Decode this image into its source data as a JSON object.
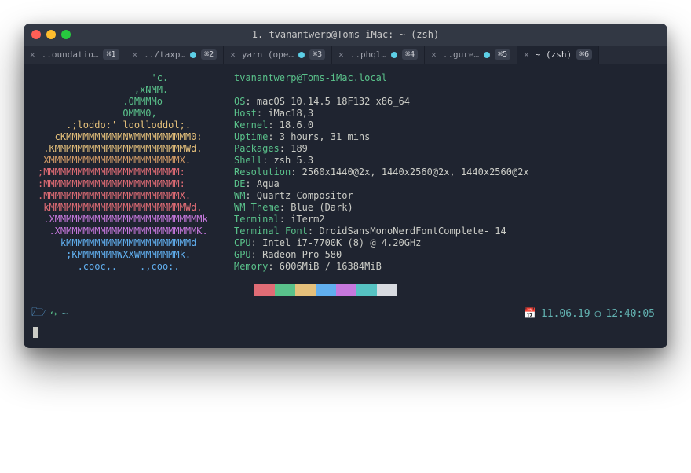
{
  "window": {
    "title": "1. tvanantwerp@Toms-iMac: ~ (zsh)"
  },
  "tabs": [
    {
      "label": "..oundatio…",
      "shortcut": "⌘1",
      "bullet": false,
      "active": false
    },
    {
      "label": "../taxp…",
      "shortcut": "⌘2",
      "bullet": true,
      "active": false
    },
    {
      "label": "yarn (ope…",
      "shortcut": "⌘3",
      "bullet": true,
      "active": false
    },
    {
      "label": "..phql…",
      "shortcut": "⌘4",
      "bullet": true,
      "active": false
    },
    {
      "label": "..gure…",
      "shortcut": "⌘5",
      "bullet": true,
      "active": false
    },
    {
      "label": "~ (zsh)",
      "shortcut": "⌘6",
      "bullet": false,
      "active": true
    }
  ],
  "ascii": [
    "                    'c.        ",
    "                 ,xNMM.        ",
    "               .OMMMMo         ",
    "               OMMM0,          ",
    "     .;loddo:' loolloddol;.    ",
    "   cKMMMMMMMMMMNWMMMMMMMMMM0:  ",
    " .KMMMMMMMMMMMMMMMMMMMMMMMWd.  ",
    " XMMMMMMMMMMMMMMMMMMMMMMMX.    ",
    ";MMMMMMMMMMMMMMMMMMMMMMMM:     ",
    ":MMMMMMMMMMMMMMMMMMMMMMMM:     ",
    ".MMMMMMMMMMMMMMMMMMMMMMMMX.    ",
    " kMMMMMMMMMMMMMMMMMMMMMMMMWd.  ",
    " .XMMMMMMMMMMMMMMMMMMMMMMMMMMk ",
    "  .XMMMMMMMMMMMMMMMMMMMMMMMMK. ",
    "    kMMMMMMMMMMMMMMMMMMMMMMd   ",
    "     ;KMMMMMMMWXXWMMMMMMMk.    ",
    "       .cooc,.    .,coo:.      "
  ],
  "neofetch": {
    "hostline": "tvanantwerp@Toms-iMac.local",
    "dash": "---------------------------",
    "rows": [
      {
        "key": "OS",
        "val": "macOS 10.14.5 18F132 x86_64"
      },
      {
        "key": "Host",
        "val": "iMac18,3"
      },
      {
        "key": "Kernel",
        "val": "18.6.0"
      },
      {
        "key": "Uptime",
        "val": "3 hours, 31 mins"
      },
      {
        "key": "Packages",
        "val": "189"
      },
      {
        "key": "Shell",
        "val": "zsh 5.3"
      },
      {
        "key": "Resolution",
        "val": "2560x1440@2x, 1440x2560@2x, 1440x2560@2x"
      },
      {
        "key": "DE",
        "val": "Aqua"
      },
      {
        "key": "WM",
        "val": "Quartz Compositor"
      },
      {
        "key": "WM Theme",
        "val": "Blue (Dark)"
      },
      {
        "key": "Terminal",
        "val": "iTerm2"
      },
      {
        "key": "Terminal Font",
        "val": "DroidSansMonoNerdFontComplete- 14"
      },
      {
        "key": "CPU",
        "val": "Intel i7-7700K (8) @ 4.20GHz"
      },
      {
        "key": "GPU",
        "val": "Radeon Pro 580"
      },
      {
        "key": "Memory",
        "val": "6006MiB / 16384MiB"
      }
    ]
  },
  "swatches": [
    "#1f2430",
    "#e06c75",
    "#5ac28b",
    "#e5c07b",
    "#61afef",
    "#c678dd",
    "#56c2c2",
    "#d7dae0"
  ],
  "status": {
    "path": "~",
    "date": "11.06.19",
    "time": "12:40:05"
  }
}
